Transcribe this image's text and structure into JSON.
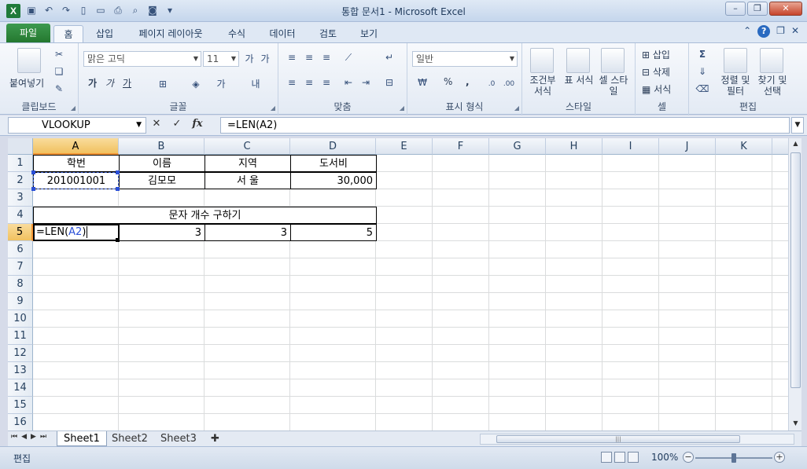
{
  "window": {
    "title": "통합 문서1 - Microsoft Excel",
    "app_icon": "excel-icon",
    "controls": [
      "minimize-icon",
      "restore-icon",
      "close-icon"
    ]
  },
  "quick_access": [
    "save-icon",
    "undo-icon",
    "redo-icon",
    "new-icon",
    "open-icon",
    "print-icon",
    "print-preview-icon",
    "camera-icon",
    "customize-icon"
  ],
  "ribbon_tabs": {
    "file": "파일",
    "tabs": [
      "홈",
      "삽입",
      "페이지 레이아웃",
      "수식",
      "데이터",
      "검토",
      "보기"
    ],
    "active": "홈"
  },
  "ribbon": {
    "clipboard": {
      "label": "클립보드",
      "paste": "붙여넣기"
    },
    "font": {
      "label": "글꼴",
      "font_name": "맑은 고딕",
      "font_size": "11",
      "bold": "가",
      "italic": "가",
      "underline": "가"
    },
    "alignment": {
      "label": "맞춤"
    },
    "number": {
      "label": "표시 형식",
      "format": "일반",
      "percent": "%",
      "comma": ","
    },
    "styles": {
      "label": "스타일",
      "conditional": "조건부 서식",
      "table": "표 서식",
      "cell_styles": "셀 스타일"
    },
    "cells": {
      "label": "셀",
      "insert": "삽입",
      "delete": "삭제",
      "format": "서식"
    },
    "editing": {
      "label": "편집",
      "sort": "정렬 및 필터",
      "find": "찾기 및 선택"
    }
  },
  "formula_bar": {
    "name_box": "VLOOKUP",
    "cancel": "✕",
    "enter": "✓",
    "fx": "fx",
    "formula": "=LEN(A2)"
  },
  "grid": {
    "columns": [
      "A",
      "B",
      "C",
      "D",
      "E",
      "F",
      "G",
      "H",
      "I",
      "J",
      "K"
    ],
    "rows": [
      "1",
      "2",
      "3",
      "4",
      "5",
      "6",
      "7",
      "8",
      "9",
      "10",
      "11",
      "12",
      "13",
      "14",
      "15",
      "16"
    ],
    "selected_column": "A",
    "selected_row": "5",
    "cells": {
      "A1": "학번",
      "B1": "이름",
      "C1": "지역",
      "D1": "도서비",
      "A2": "201001001",
      "B2": "김모모",
      "C2": "서 울",
      "D2": "30,000",
      "A4": "문자 개수 구하기",
      "A5_prefix": "=LEN(",
      "A5_ref": "A2",
      "A5_suffix": ")",
      "B5": "3",
      "C5": "3",
      "D5": "5"
    }
  },
  "sheets": {
    "tabs": [
      "Sheet1",
      "Sheet2",
      "Sheet3"
    ],
    "active": "Sheet1",
    "insert_icon": "insert-sheet-icon"
  },
  "status": {
    "mode": "편집",
    "zoom": "100%",
    "zoom_minus": "−",
    "zoom_plus": "+"
  },
  "colors": {
    "reference_blue": "#2a4fd8",
    "file_tab_green": "#2f8a3f",
    "selection_orange": "#f1c15f"
  }
}
